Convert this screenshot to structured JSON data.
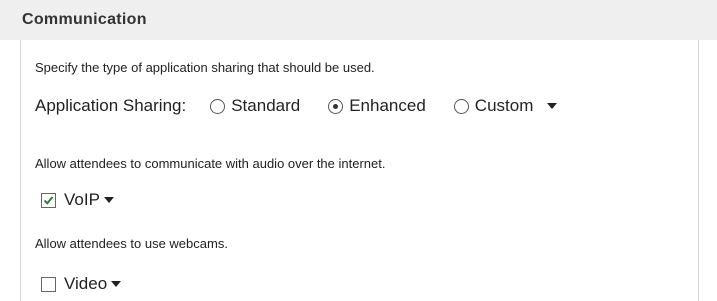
{
  "section": {
    "title": "Communication"
  },
  "sharing": {
    "description": "Specify the type of application sharing that should be used.",
    "label": "Application Sharing:",
    "options": [
      {
        "label": "Standard",
        "selected": false
      },
      {
        "label": "Enhanced",
        "selected": true
      },
      {
        "label": "Custom",
        "selected": false
      }
    ]
  },
  "audio": {
    "description": "Allow attendees to communicate with audio over the internet.",
    "voip_label": "VoIP",
    "voip_checked": true
  },
  "webcam": {
    "description": "Allow attendees to use webcams.",
    "video_label": "Video",
    "video_checked": false
  },
  "colors": {
    "header_bg": "#efefef",
    "check_mark": "#2e7d32"
  }
}
